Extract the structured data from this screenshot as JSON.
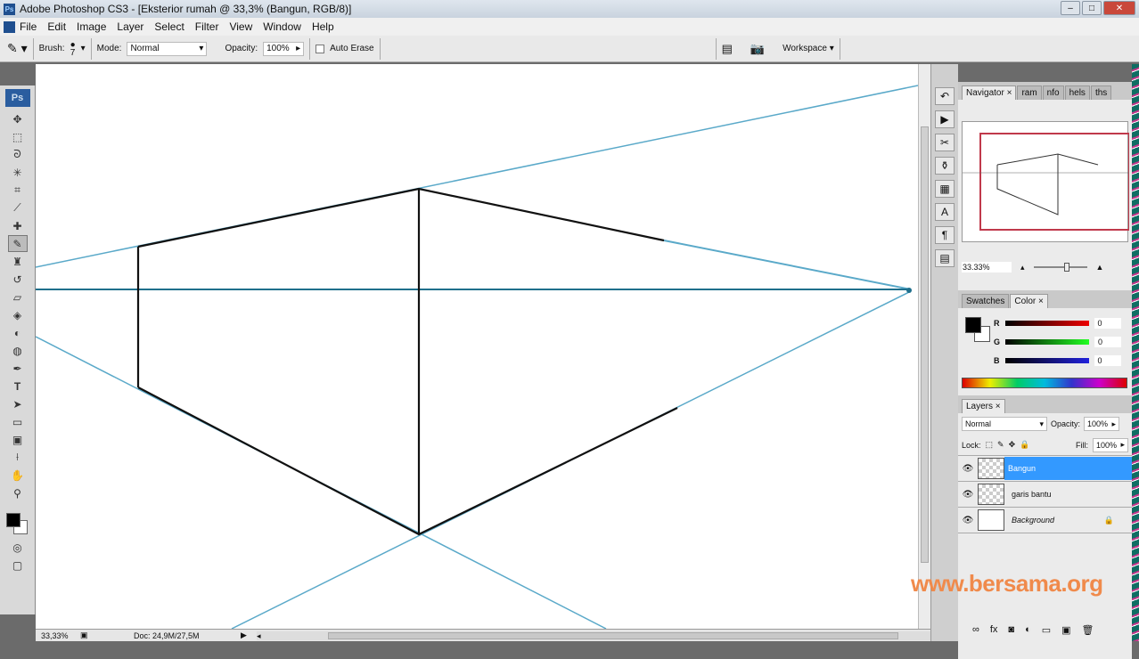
{
  "window": {
    "title": "Adobe Photoshop CS3 - [Eksterior rumah @ 33,3% (Bangun, RGB/8)]",
    "app_icon": "Ps"
  },
  "menu": [
    "File",
    "Edit",
    "Image",
    "Layer",
    "Select",
    "Filter",
    "View",
    "Window",
    "Help"
  ],
  "options": {
    "brush_label": "Brush:",
    "brush_size": "7",
    "mode_label": "Mode:",
    "mode_value": "Normal",
    "opacity_label": "Opacity:",
    "opacity_value": "100%",
    "auto_erase_label": "Auto Erase",
    "auto_erase_checked": false,
    "workspace_label": "Workspace"
  },
  "toolbox": {
    "logo": "Ps",
    "tools": [
      "move",
      "marquee",
      "lasso",
      "magic-wand",
      "crop",
      "slice",
      "healing",
      "pencil",
      "clone-stamp",
      "history-brush",
      "eraser",
      "paint-bucket",
      "dodge",
      "burn",
      "pen",
      "type",
      "path-select",
      "rectangle",
      "notes",
      "eyedropper",
      "hand",
      "zoom"
    ],
    "active_tool": "pencil"
  },
  "status": {
    "zoom": "33,33%",
    "doc": "Doc: 24,9M/27,5M"
  },
  "navigator": {
    "tabs": [
      "Navigator",
      "ram",
      "nfo",
      "hels",
      "ths"
    ],
    "zoom": "33.33%"
  },
  "color": {
    "tabs": [
      "Swatches",
      "Color"
    ],
    "channels": [
      {
        "label": "R",
        "value": "0"
      },
      {
        "label": "G",
        "value": "0"
      },
      {
        "label": "B",
        "value": "0"
      }
    ],
    "foreground": "#000000",
    "background": "#ffffff"
  },
  "layers": {
    "tab": "Layers",
    "blend_mode": "Normal",
    "opacity_label": "Opacity:",
    "opacity": "100%",
    "lock_label": "Lock:",
    "fill_label": "Fill:",
    "fill": "100%",
    "items": [
      {
        "name": "Bangun",
        "selected": true
      },
      {
        "name": "garis bantu",
        "selected": false
      },
      {
        "name": "Background",
        "selected": false,
        "locked": true
      }
    ]
  },
  "watermark": "www.bersama.org",
  "colors": {
    "guide": "#5aa9c9",
    "horizon": "#1f6f8c",
    "selection": "#3399ff"
  }
}
